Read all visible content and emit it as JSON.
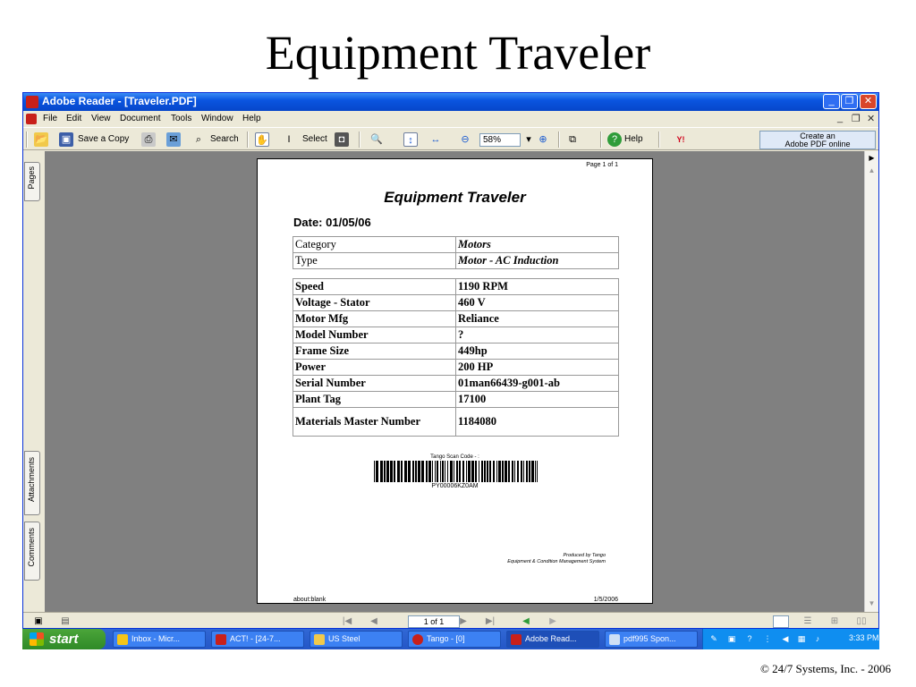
{
  "slide": {
    "title": "Equipment Traveler",
    "footer": "© 24/7 Systems, Inc. - 2006"
  },
  "window": {
    "title": "Adobe Reader - [Traveler.PDF]",
    "menu": [
      "File",
      "Edit",
      "View",
      "Document",
      "Tools",
      "Window",
      "Help"
    ]
  },
  "toolbar": {
    "save_copy": "Save a Copy",
    "search": "Search",
    "select": "Select",
    "zoom_value": "58%",
    "help": "Help",
    "create_pdf_line1": "Create an",
    "create_pdf_line2": "Adobe PDF online"
  },
  "side_tabs": {
    "pages": "Pages",
    "attachments": "Attachments",
    "comments": "Comments"
  },
  "document": {
    "page_indicator": "Page 1 of 1",
    "title": "Equipment Traveler",
    "date": "Date: 01/05/06",
    "table1": [
      {
        "key": "Category",
        "value": "Motors"
      },
      {
        "key": "Type",
        "value": "Motor - AC Induction"
      }
    ],
    "table2": [
      {
        "key": "Speed",
        "value": "1190 RPM"
      },
      {
        "key": "Voltage - Stator",
        "value": "460 V"
      },
      {
        "key": "Motor Mfg",
        "value": "Reliance"
      },
      {
        "key": "Model Number",
        "value": "?"
      },
      {
        "key": "Frame Size",
        "value": "449hp"
      },
      {
        "key": "Power",
        "value": "200 HP"
      },
      {
        "key": "Serial Number",
        "value": "01man66439-g001-ab"
      },
      {
        "key": "Plant Tag",
        "value": "17100"
      },
      {
        "key": "Materials Master Number",
        "value": "1184080"
      }
    ],
    "scan_label": "Tango Scan Code - :",
    "barcode_text": "PY00006KZ0AM",
    "produced_line1": "Produced by Tango",
    "produced_line2": "Equipment & Condition Management System",
    "footer_left": "about:blank",
    "footer_right": "1/5/2006"
  },
  "statusbar": {
    "page_field": "1 of 1"
  },
  "taskbar": {
    "start": "start",
    "tasks": [
      "Inbox - Micr...",
      "ACT! - [24-7...",
      "US Steel",
      "Tango - [0]",
      "Adobe Read...",
      "pdf995 Spon..."
    ],
    "clock": "3:33 PM"
  },
  "colors": {
    "titlebar": "#0a55e0",
    "taskbar": "#2456c6",
    "start": "#3a9a30",
    "doc_background": "#808080"
  }
}
